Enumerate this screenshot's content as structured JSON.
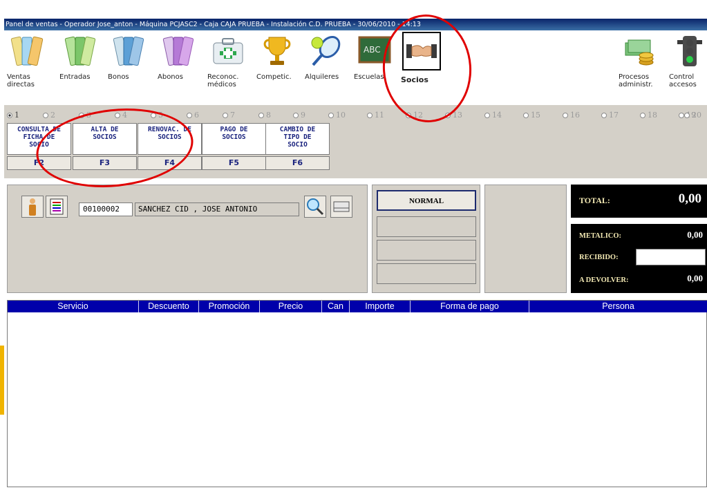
{
  "window": {
    "title": "Panel de ventas - Operador Jose_anton - Máquina PCJASC2 - Caja CAJA PRUEBA - Instalación C.D. PRUEBA - 30/06/2010 - 14:13"
  },
  "toolbar": {
    "items": [
      {
        "label": "Ventas\ndirectas",
        "icon": "ticket-icon"
      },
      {
        "label": "Entradas",
        "icon": "ticket-icon"
      },
      {
        "label": "Bonos",
        "icon": "ticket-icon"
      },
      {
        "label": "Abonos",
        "icon": "ticket-icon"
      },
      {
        "label": "Reconoc.\nmédicos",
        "icon": "medical-kit-icon"
      },
      {
        "label": "Competic.",
        "icon": "trophy-icon"
      },
      {
        "label": "Alquileres",
        "icon": "tennis-racket-icon"
      },
      {
        "label": "Escuelas",
        "icon": "chalkboard-icon"
      },
      {
        "label": "Socios",
        "icon": "handshake-icon"
      },
      {
        "label": "Procesos\nadministr.",
        "icon": "money-icon"
      },
      {
        "label": "Control\naccesos",
        "icon": "traffic-light-icon"
      }
    ]
  },
  "radios": [
    "1",
    "2",
    "3",
    "4",
    "5",
    "6",
    "7",
    "8",
    "9",
    "10",
    "11",
    "12",
    "13",
    "14",
    "15",
    "16",
    "17",
    "18",
    "19",
    "20"
  ],
  "function_buttons": [
    {
      "label": "CONSULTA DE\nFICHA DE\nSOCIO",
      "key": "F2"
    },
    {
      "label": "ALTA DE\nSOCIOS",
      "key": "F3"
    },
    {
      "label": "RENOVAC. DE\nSOCIOS",
      "key": "F4"
    },
    {
      "label": "PAGO DE\nSOCIOS",
      "key": "F5"
    },
    {
      "label": "CAMBIO DE\nTIPO DE\nSOCIO",
      "key": "F6"
    }
  ],
  "customer": {
    "id": "00100002",
    "name": "SANCHEZ CID , JOSE ANTONIO"
  },
  "type_buttons": [
    "NORMAL",
    "",
    "",
    ""
  ],
  "totals": {
    "total_label": "TOTAL:",
    "total_value": "0,00",
    "metalico_label": "METALICO:",
    "metalico_value": "0,00",
    "recibido_label": "RECIBIDO:",
    "devolver_label": "A DEVOLVER:",
    "devolver_value": "0,00"
  },
  "table": {
    "columns": [
      "Servicio",
      "Descuento",
      "Promoción",
      "Precio",
      "Can",
      "Importe",
      "Forma de pago",
      "Persona"
    ]
  },
  "colors": {
    "highlight": "#e00000",
    "table_header": "#0000aa",
    "panel_gray": "#d4d0c8"
  }
}
